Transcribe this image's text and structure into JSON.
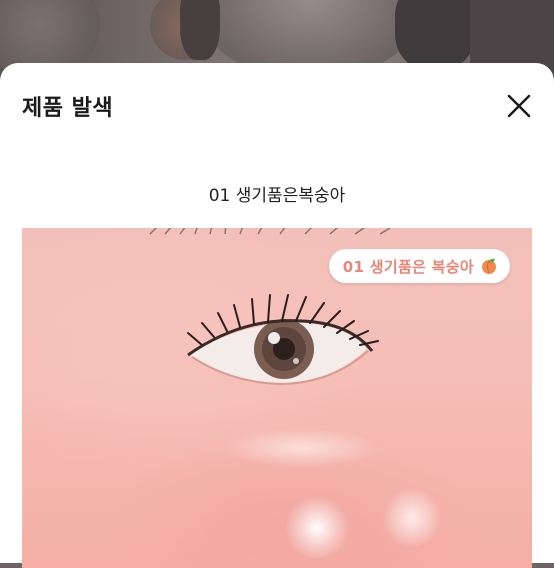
{
  "sheet": {
    "title": "제품 발색",
    "close_icon": "close-icon"
  },
  "shade": {
    "name": "01 생기품은복숭아"
  },
  "swatch": {
    "badge_text": "01 생기품은 복숭아",
    "badge_icon": "peach-icon",
    "accent_color": "#e98575"
  }
}
